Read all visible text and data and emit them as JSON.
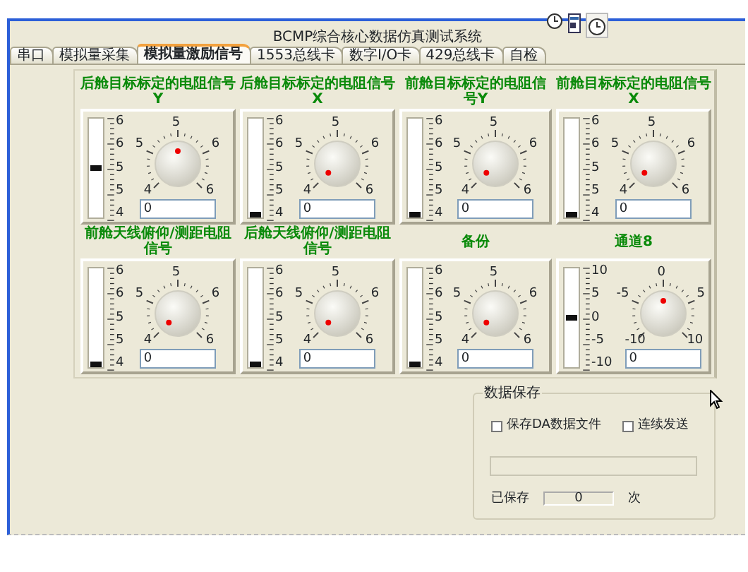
{
  "window": {
    "title": "BCMP综合核心数据仿真测试系统"
  },
  "tabs": [
    {
      "label": "串口",
      "selected": false
    },
    {
      "label": "模拟量采集",
      "selected": false
    },
    {
      "label": "模拟量激励信号",
      "selected": true
    },
    {
      "label": "1553总线卡",
      "selected": false
    },
    {
      "label": "数字I/O卡",
      "selected": false
    },
    {
      "label": "429总线卡",
      "selected": false
    },
    {
      "label": "自检",
      "selected": false
    }
  ],
  "channels": [
    {
      "title": "后舱目标标定的电阻信号Y",
      "scale_labels": [
        "6",
        "6",
        "5",
        "5",
        "4"
      ],
      "dial_labels": [
        "5",
        "5",
        "6",
        "4",
        "6"
      ],
      "slider": {
        "level": 0.5
      },
      "value": "0"
    },
    {
      "title": "后舱目标标定的电阻信号X",
      "scale_labels": [
        "6",
        "6",
        "5",
        "5",
        "4"
      ],
      "dial_labels": [
        "5",
        "5",
        "6",
        "4",
        "6"
      ],
      "slider": {
        "level": 0
      },
      "value": "0"
    },
    {
      "title": "前舱目标标定的电阻信号Y",
      "scale_labels": [
        "6",
        "6",
        "5",
        "5",
        "4"
      ],
      "dial_labels": [
        "5",
        "5",
        "6",
        "4",
        "6"
      ],
      "slider": {
        "level": 0
      },
      "value": "0"
    },
    {
      "title": "前舱目标标定的电阻信号X",
      "scale_labels": [
        "6",
        "6",
        "5",
        "5",
        "4"
      ],
      "dial_labels": [
        "5",
        "5",
        "6",
        "4",
        "6"
      ],
      "slider": {
        "level": 0
      },
      "value": "0"
    },
    {
      "title": "前舱天线俯仰/测距电阻信号",
      "scale_labels": [
        "6",
        "6",
        "5",
        "5",
        "4"
      ],
      "dial_labels": [
        "5",
        "5",
        "6",
        "4",
        "6"
      ],
      "slider": {
        "level": 0
      },
      "value": "0"
    },
    {
      "title": "后舱天线俯仰/测距电阻信号",
      "scale_labels": [
        "6",
        "6",
        "5",
        "5",
        "4"
      ],
      "dial_labels": [
        "5",
        "5",
        "6",
        "4",
        "6"
      ],
      "slider": {
        "level": 0
      },
      "value": "0"
    },
    {
      "title": "备份",
      "scale_labels": [
        "6",
        "6",
        "5",
        "5",
        "4"
      ],
      "dial_labels": [
        "5",
        "5",
        "6",
        "4",
        "6"
      ],
      "slider": {
        "level": 0
      },
      "value": "0"
    },
    {
      "title": "通道8",
      "scale_labels": [
        "10",
        "5",
        "0",
        "-5",
        "-10"
      ],
      "dial_labels": [
        "0",
        "-5",
        "5",
        "-10",
        "10"
      ],
      "slider": {
        "level": 0.5
      },
      "value": "0"
    }
  ],
  "data_save": {
    "title": "数据保存",
    "checkboxes": [
      {
        "label": "保存DA数据文件",
        "checked": false
      },
      {
        "label": "连续发送",
        "checked": false
      }
    ],
    "saved_label": "已保存",
    "saved_count": "0",
    "unit": "次"
  }
}
